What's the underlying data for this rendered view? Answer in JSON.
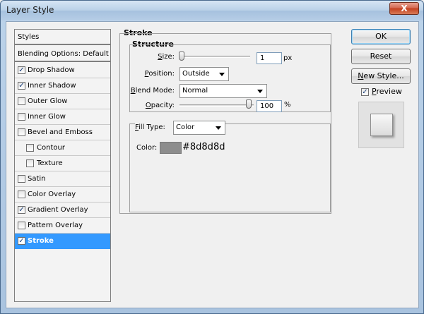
{
  "window": {
    "title": "Layer Style",
    "close_label": "X"
  },
  "styles_list": {
    "header": "Styles",
    "blending_options": "Blending Options: Default",
    "items": [
      {
        "label": "Drop Shadow",
        "checked": true
      },
      {
        "label": "Inner Shadow",
        "checked": true
      },
      {
        "label": "Outer Glow",
        "checked": false
      },
      {
        "label": "Inner Glow",
        "checked": false
      },
      {
        "label": "Bevel and Emboss",
        "checked": false
      },
      {
        "label": "Contour",
        "checked": false
      },
      {
        "label": "Texture",
        "checked": false
      },
      {
        "label": "Satin",
        "checked": false
      },
      {
        "label": "Color Overlay",
        "checked": false
      },
      {
        "label": "Gradient Overlay",
        "checked": true
      },
      {
        "label": "Pattern Overlay",
        "checked": false
      },
      {
        "label": "Stroke",
        "checked": true,
        "selected": true
      }
    ]
  },
  "stroke": {
    "title": "Stroke",
    "structure": {
      "title": "Structure",
      "size_label": "Size:",
      "size_value": "1",
      "size_unit": "px",
      "size_level": 0.0,
      "position_label": "Position:",
      "position_value": "Outside",
      "blend_mode_label": "Blend Mode:",
      "blend_mode_value": "Normal",
      "opacity_label": "Opacity:",
      "opacity_value": "100",
      "opacity_unit": "%",
      "opacity_level": 1.0
    },
    "fill": {
      "fill_type_label": "Fill Type:",
      "fill_type_value": "Color",
      "color_label": "Color:",
      "color_hex": "#8d8d8d"
    }
  },
  "buttons": {
    "ok": "OK",
    "reset": "Reset",
    "new_style": "New Style..."
  },
  "preview": {
    "label": "Preview",
    "checked": true
  },
  "colors": {
    "accent": "#3399ff",
    "swatch": "#8d8d8d"
  }
}
